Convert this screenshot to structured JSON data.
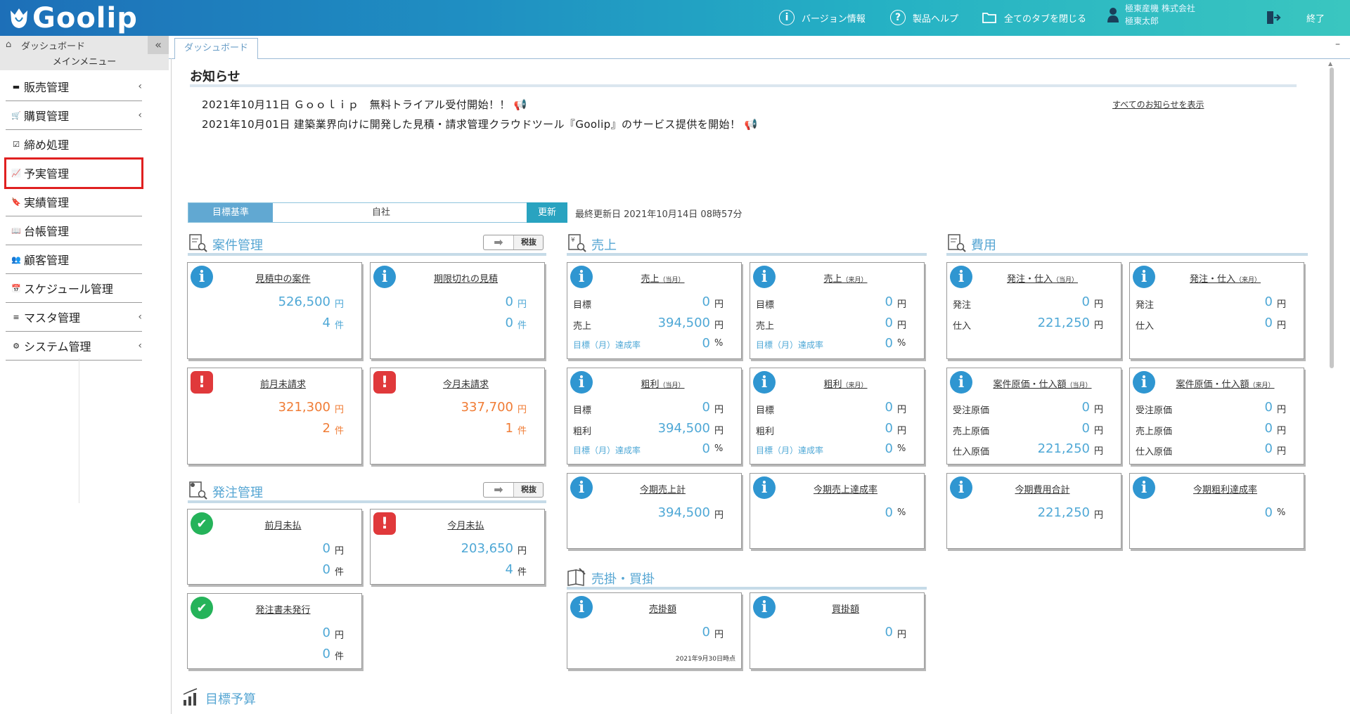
{
  "header": {
    "logo": "Goolip",
    "version_info": "バージョン情報",
    "help": "製品ヘルプ",
    "close_tabs": "全てのタブを閉じる",
    "company": "極東産機 株式会社",
    "user": "極東太郎",
    "exit": "終了"
  },
  "sidebar": {
    "breadcrumb": "ダッシュボード",
    "collapse": "«",
    "menu_title": "メインメニュー",
    "items": [
      {
        "label": "販売管理",
        "icon": "register-icon",
        "has_submenu": true
      },
      {
        "label": "購買管理",
        "icon": "cart-icon",
        "has_submenu": true
      },
      {
        "label": "締め処理",
        "icon": "checkbox-icon",
        "has_submenu": false
      },
      {
        "label": "予実管理",
        "icon": "chart-line-icon",
        "has_submenu": false,
        "highlighted": true
      },
      {
        "label": "実績管理",
        "icon": "bookmark-icon",
        "has_submenu": false
      },
      {
        "label": "台帳管理",
        "icon": "book-icon",
        "has_submenu": false
      },
      {
        "label": "顧客管理",
        "icon": "users-icon",
        "has_submenu": false
      },
      {
        "label": "スケジュール管理",
        "icon": "calendar-icon",
        "has_submenu": false
      },
      {
        "label": "マスタ管理",
        "icon": "database-icon",
        "has_submenu": true
      },
      {
        "label": "システム管理",
        "icon": "gear-icon",
        "has_submenu": true
      }
    ]
  },
  "tabs": {
    "active": "ダッシュボード",
    "minimize": "–"
  },
  "notices": {
    "title": "お知らせ",
    "items": [
      "2021年10月11日 Ｇｏｏｌｉｐ　無料トライアル受付開始！！ 📢",
      "2021年10月01日 建築業界向けに開発した見積・請求管理クラウドツール『Goolip』のサービス提供を開始！ 📢"
    ],
    "show_all": "すべてのお知らせを表示"
  },
  "filter": {
    "label": "目標基準",
    "value": "自社",
    "update": "更新",
    "last_updated": "最終更新日 2021年10月14日 08時57分"
  },
  "sections": {
    "anken": "案件管理",
    "uriage": "売上",
    "hiyou": "費用",
    "hacchu": "発注管理",
    "urikake": "売掛・買掛",
    "mokuhyo": "目標予算",
    "tax_toggle": "税抜"
  },
  "units": {
    "yen": "円",
    "ken": "件",
    "pct": "%"
  },
  "cards": {
    "mitsumori": {
      "title": "見積中の案件",
      "amount": "526,500",
      "count": "4"
    },
    "kigengire": {
      "title": "期限切れの見積",
      "amount": "0",
      "count": "0"
    },
    "zengetsu_miseikyu": {
      "title": "前月未請求",
      "amount": "321,300",
      "count": "2"
    },
    "kongetsu_miseikyu": {
      "title": "今月未請求",
      "amount": "337,700",
      "count": "1"
    },
    "uriage_tougetsu": {
      "title": "売上",
      "period": "（当月）",
      "target_label": "目標",
      "target": "0",
      "actual_label": "売上",
      "actual": "394,500",
      "rate_label": "目標（月）達成率",
      "rate": "0"
    },
    "uriage_raigetsu": {
      "title": "売上",
      "period": "（来月）",
      "target_label": "目標",
      "target": "0",
      "actual_label": "売上",
      "actual": "0",
      "rate_label": "目標（月）達成率",
      "rate": "0"
    },
    "arari_tougetsu": {
      "title": "粗利",
      "period": "（当月）",
      "target_label": "目標",
      "target": "0",
      "actual_label": "粗利",
      "actual": "394,500",
      "rate_label": "目標（月）達成率",
      "rate": "0"
    },
    "arari_raigetsu": {
      "title": "粗利",
      "period": "（来月）",
      "target_label": "目標",
      "target": "0",
      "actual_label": "粗利",
      "actual": "0",
      "rate_label": "目標（月）達成率",
      "rate": "0"
    },
    "kouki_uriage": {
      "title": "今期売上計",
      "amount": "394,500"
    },
    "kouki_tassei": {
      "title": "今期売上達成率",
      "rate": "0"
    },
    "hacchu_tougetsu": {
      "title": "発注・仕入",
      "period": "（当月）",
      "order_label": "発注",
      "order": "0",
      "purchase_label": "仕入",
      "purchase": "221,250"
    },
    "hacchu_raigetsu": {
      "title": "発注・仕入",
      "period": "（来月）",
      "order_label": "発注",
      "order": "0",
      "purchase_label": "仕入",
      "purchase": "0"
    },
    "genka_tougetsu": {
      "title": "案件原価・仕入額",
      "period": "（当月）",
      "l1": "受注原価",
      "v1": "0",
      "l2": "売上原価",
      "v2": "0",
      "l3": "仕入原価",
      "v3": "221,250"
    },
    "genka_raigetsu": {
      "title": "案件原価・仕入額",
      "period": "（来月）",
      "l1": "受注原価",
      "v1": "0",
      "l2": "売上原価",
      "v2": "0",
      "l3": "仕入原価",
      "v3": "0"
    },
    "kouki_hiyou": {
      "title": "今期費用合計",
      "amount": "221,250"
    },
    "kouki_arari": {
      "title": "今期粗利達成率",
      "rate": "0"
    },
    "zengetsu_miharai": {
      "title": "前月未払",
      "amount": "0",
      "count": "0"
    },
    "kongetsu_miharai": {
      "title": "今月未払",
      "amount": "203,650",
      "count": "4"
    },
    "hacchusho": {
      "title": "発注書未発行",
      "amount": "0",
      "count": "0"
    },
    "urikake": {
      "title": "売掛額",
      "amount": "0",
      "note": "2021年9月30日時点"
    },
    "kaikake": {
      "title": "買掛額",
      "amount": "0"
    }
  },
  "colors": {
    "accent": "#4fa8d6",
    "warning": "#f07c35",
    "alert": "#e0393b",
    "ok": "#25b35a",
    "header_from": "#1d6fb8",
    "header_to": "#3ac6c0"
  }
}
